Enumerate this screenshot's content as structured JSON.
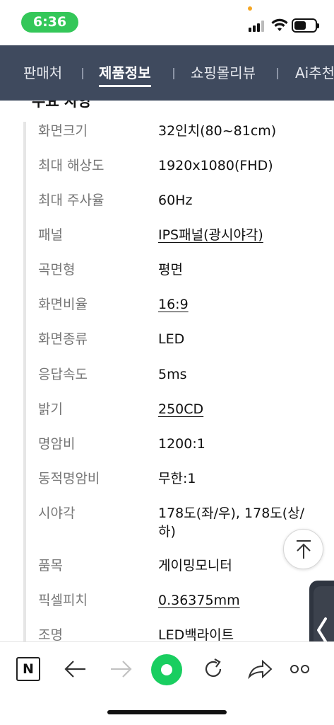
{
  "status": {
    "time": "6:36"
  },
  "tabs": [
    {
      "label": "판매처",
      "active": false
    },
    {
      "label": "제품정보",
      "active": true
    },
    {
      "label": "쇼핑몰리뷰",
      "active": false
    },
    {
      "label": "Ai추천",
      "active": false
    }
  ],
  "section_heading": "주요 사양",
  "specs": [
    {
      "label": "화면크기",
      "value": "32인치(80~81cm)",
      "link": false
    },
    {
      "label": "최대 해상도",
      "value": "1920x1080(FHD)",
      "link": false
    },
    {
      "label": "최대 주사율",
      "value": "60Hz",
      "link": false
    },
    {
      "label": "패널",
      "value": "IPS패널(광시야각)",
      "link": true
    },
    {
      "label": "곡면형",
      "value": "평면",
      "link": false
    },
    {
      "label": "화면비율",
      "value": "16:9",
      "link": true
    },
    {
      "label": "화면종류",
      "value": "LED",
      "link": false
    },
    {
      "label": "응답속도",
      "value": "5ms",
      "link": false
    },
    {
      "label": "밝기",
      "value": "250CD",
      "link": true
    },
    {
      "label": "명암비",
      "value": "1200:1",
      "link": false
    },
    {
      "label": "동적명암비",
      "value": "무한:1",
      "link": false
    },
    {
      "label": "시야각",
      "value": "178도(좌/우), 178도(상/하)",
      "link": false
    },
    {
      "label": "품목",
      "value": "게이밍모니터",
      "link": false
    },
    {
      "label": "픽셀피치",
      "value": "0.36375mm",
      "link": true
    },
    {
      "label": "조명",
      "value": "LED백라이트",
      "link": false
    }
  ],
  "toolbar": {
    "n_label": "N",
    "icons": [
      "n-logo-icon",
      "back-arrow-icon",
      "forward-arrow-icon",
      "green-home-icon",
      "refresh-icon",
      "share-icon",
      "more-icon"
    ]
  },
  "colors": {
    "tabbar_bg": "#3f4a5e",
    "status_time_bg": "#34c759",
    "green_button": "#19ce60",
    "label_gray": "#777777"
  }
}
